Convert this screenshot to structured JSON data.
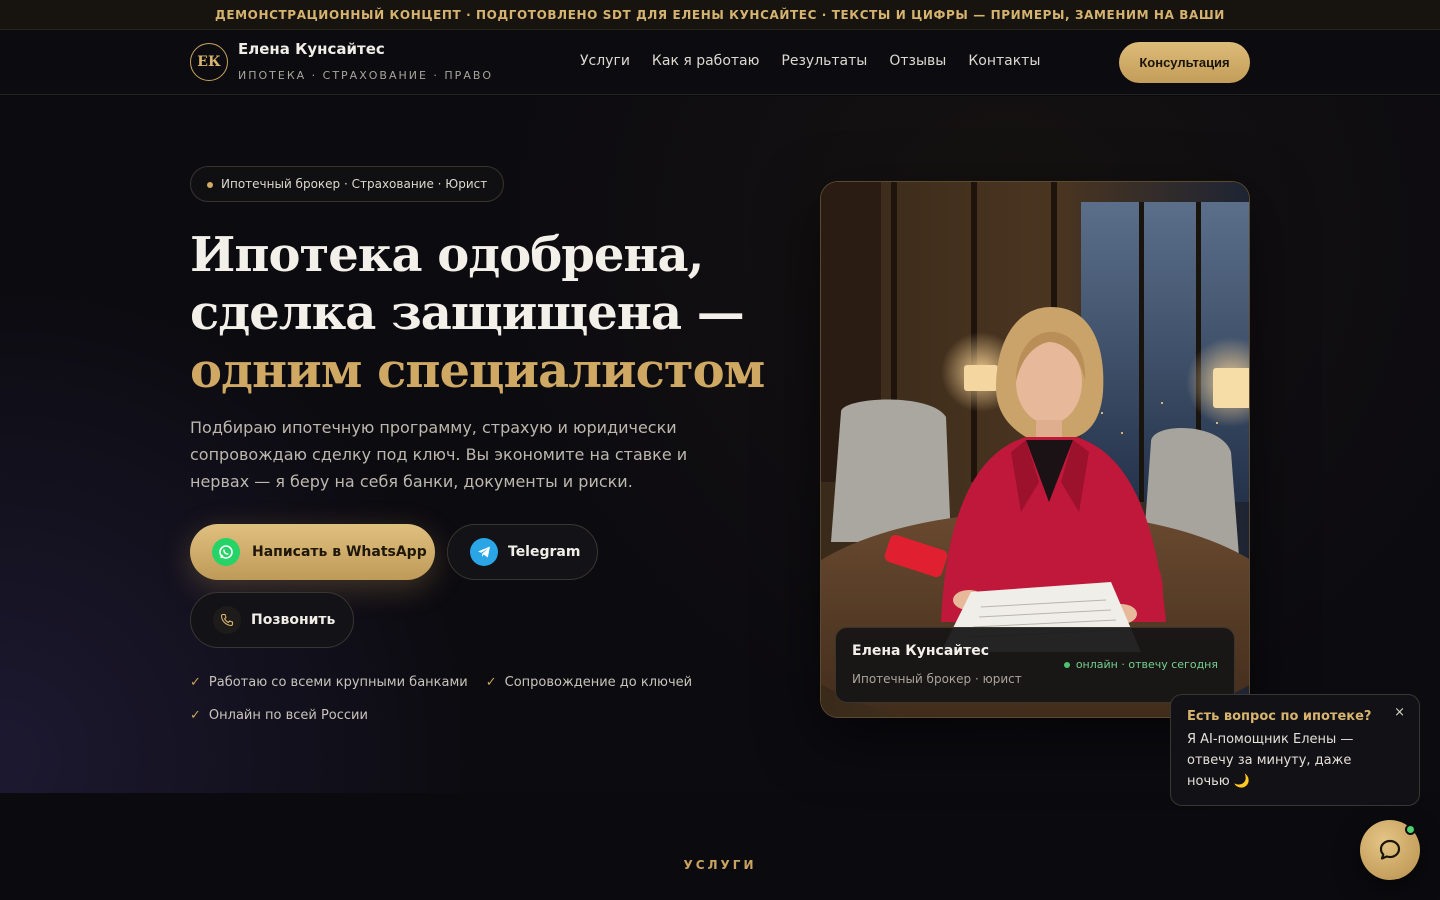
{
  "topbar": {
    "text": "ДЕМОНСТРАЦИОННЫЙ КОНЦЕПТ · ПОДГОТОВЛЕНО SDT ДЛЯ ЕЛЕНЫ КУНСАЙТЕС · ТЕКСТЫ И ЦИФРЫ — ПРИМЕРЫ, ЗАМЕНИМ НА ВАШИ"
  },
  "header": {
    "logo_initials": "ЕК",
    "brand_name": "Елена Кунсайтес",
    "brand_sub": "ИПОТЕКА · СТРАХОВАНИЕ · ПРАВО",
    "nav": [
      "Услуги",
      "Как я работаю",
      "Результаты",
      "Отзывы",
      "Контакты"
    ],
    "cta_label": "Консультация"
  },
  "hero": {
    "pill": "Ипотечный брокер · Страхование · Юрист",
    "title_line1": "Ипотека одобрена,",
    "title_line2": "сделка защищена —",
    "title_accent": "одним специалистом",
    "lead": "Подбираю ипотечную программу, страхую и юридически сопровождаю сделку под ключ. Вы экономите на ставке и нервах — я беру на себя банки, документы и риски.",
    "btn_whatsapp": "Написать в WhatsApp",
    "btn_telegram": "Telegram",
    "btn_call": "Позвонить",
    "checks": [
      "Работаю со всеми крупными банками",
      "Сопровождение до ключей",
      "Онлайн по всей России"
    ]
  },
  "profile_card": {
    "name": "Елена Кунсайтес",
    "role": "Ипотечный брокер · юрист",
    "status": "онлайн · отвечу сегодня"
  },
  "chat_popup": {
    "title": "Есть вопрос по ипотеке?",
    "text": "Я AI-помощник Елены — отвечу за минуту, даже ночью 🌙",
    "close": "×"
  },
  "section": {
    "label": "УСЛУГИ"
  },
  "colors": {
    "accent_gold": "#cfa964",
    "background": "#0b0b0f",
    "whatsapp": "#25d366",
    "telegram": "#2aa6e6",
    "online": "#4cc36d"
  }
}
